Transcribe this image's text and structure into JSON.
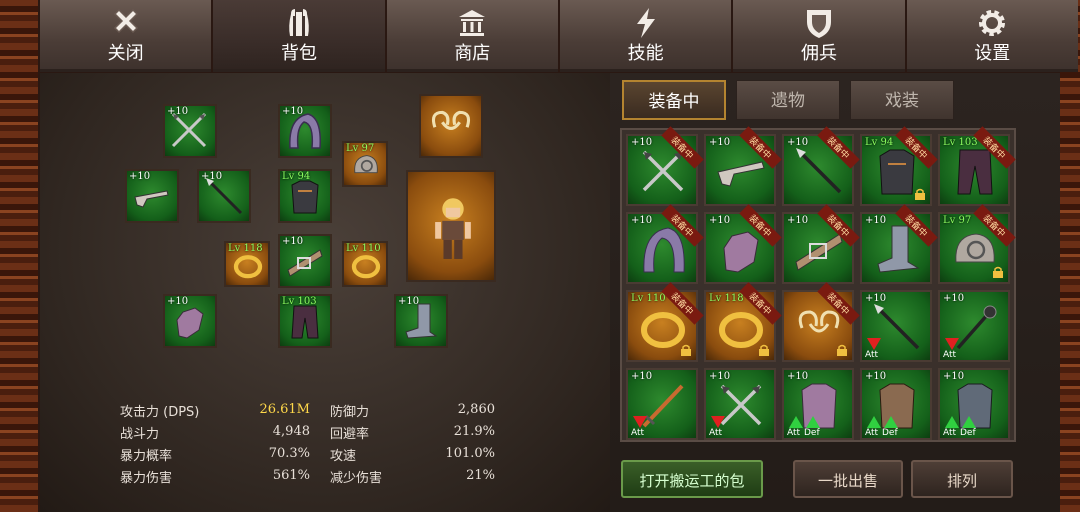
{
  "top_tabs": [
    {
      "label": "关闭",
      "icon": "close-icon"
    },
    {
      "label": "背包",
      "icon": "backpack-icon",
      "active": true
    },
    {
      "label": "商店",
      "icon": "shop-icon"
    },
    {
      "label": "技能",
      "icon": "skill-icon"
    },
    {
      "label": "佣兵",
      "icon": "mercenary-shield-icon"
    },
    {
      "label": "设置",
      "icon": "gear-icon"
    }
  ],
  "equipped_slots": [
    {
      "name": "weapon-crossed-swords",
      "level": "+10",
      "color": "green"
    },
    {
      "name": "helmet-hood",
      "level": "+10",
      "color": "green"
    },
    {
      "name": "offhand-pistol",
      "level": "+10",
      "color": "green"
    },
    {
      "name": "spear",
      "level": "+10",
      "color": "green"
    },
    {
      "name": "shoulder",
      "level": "Lv 97",
      "color": "orange"
    },
    {
      "name": "armor",
      "level": "Lv 94",
      "color": "green"
    },
    {
      "name": "amulet",
      "level": "",
      "color": "orange"
    },
    {
      "name": "ring-left",
      "level": "Lv 118",
      "color": "orange"
    },
    {
      "name": "belt",
      "level": "+10",
      "color": "green"
    },
    {
      "name": "ring-right",
      "level": "Lv 110",
      "color": "orange"
    },
    {
      "name": "gloves",
      "level": "+10",
      "color": "green"
    },
    {
      "name": "pants",
      "level": "Lv 103",
      "color": "green"
    },
    {
      "name": "boots",
      "level": "+10",
      "color": "green"
    }
  ],
  "stats": {
    "left": [
      {
        "label": "攻击力 (DPS)",
        "value": "26.61M",
        "highlight": true
      },
      {
        "label": "战斗力",
        "value": "4,948"
      },
      {
        "label": "暴力概率",
        "value": "70.3%"
      },
      {
        "label": "暴力伤害",
        "value": "561%"
      }
    ],
    "right": [
      {
        "label": "防御力",
        "value": "2,860"
      },
      {
        "label": "回避率",
        "value": "21.9%"
      },
      {
        "label": "攻速",
        "value": "101.0%"
      },
      {
        "label": "减少伤害",
        "value": "21%"
      }
    ]
  },
  "inventory_tabs": [
    {
      "label": "装备中",
      "active": true
    },
    {
      "label": "遗物"
    },
    {
      "label": "戏装"
    }
  ],
  "equipped_tag": "装备中",
  "inventory": [
    {
      "level": "+10",
      "item": "swords",
      "color": "green",
      "equipped": true
    },
    {
      "level": "+10",
      "item": "pistol",
      "color": "green",
      "equipped": true
    },
    {
      "level": "+10",
      "item": "spear",
      "color": "green",
      "equipped": true
    },
    {
      "level": "Lv 94",
      "item": "armor",
      "color": "green",
      "equipped": true,
      "locked": true
    },
    {
      "level": "Lv 103",
      "item": "pants",
      "color": "green",
      "equipped": true
    },
    {
      "level": "+10",
      "item": "hood",
      "color": "green",
      "equipped": true
    },
    {
      "level": "+10",
      "item": "gloves",
      "color": "green",
      "equipped": true
    },
    {
      "level": "+10",
      "item": "belt",
      "color": "green",
      "equipped": true
    },
    {
      "level": "+10",
      "item": "boots",
      "color": "green",
      "equipped": true
    },
    {
      "level": "Lv 97",
      "item": "shoulder",
      "color": "green",
      "equipped": true,
      "locked": true
    },
    {
      "level": "Lv 110",
      "item": "ring",
      "color": "orange",
      "equipped": true,
      "locked": true
    },
    {
      "level": "Lv 118",
      "item": "ring",
      "color": "orange",
      "equipped": true,
      "locked": true
    },
    {
      "level": "",
      "item": "amulet",
      "color": "orange",
      "equipped": true,
      "locked": true
    },
    {
      "level": "+10",
      "item": "spear",
      "color": "green",
      "att": "down"
    },
    {
      "level": "+10",
      "item": "mace",
      "color": "green",
      "att": "down"
    },
    {
      "level": "+10",
      "item": "sword",
      "color": "green",
      "att": "down"
    },
    {
      "level": "+10",
      "item": "swords",
      "color": "green",
      "att": "down"
    },
    {
      "level": "+10",
      "item": "chest",
      "color": "green",
      "att": "up",
      "def": "up"
    },
    {
      "level": "+10",
      "item": "chest-brown",
      "color": "green",
      "att": "up",
      "def": "up"
    },
    {
      "level": "+10",
      "item": "chest-steel",
      "color": "green",
      "att": "up",
      "def": "up"
    }
  ],
  "att_label": "Att",
  "def_label": "Def",
  "buttons": {
    "open_porter": "打开搬运工的包",
    "bulk_sell": "一批出售",
    "sort": "排列"
  },
  "colors": {
    "green_slot": "#1a6e1e",
    "orange_slot": "#b06a18",
    "accent_gold": "#ffd84a"
  }
}
